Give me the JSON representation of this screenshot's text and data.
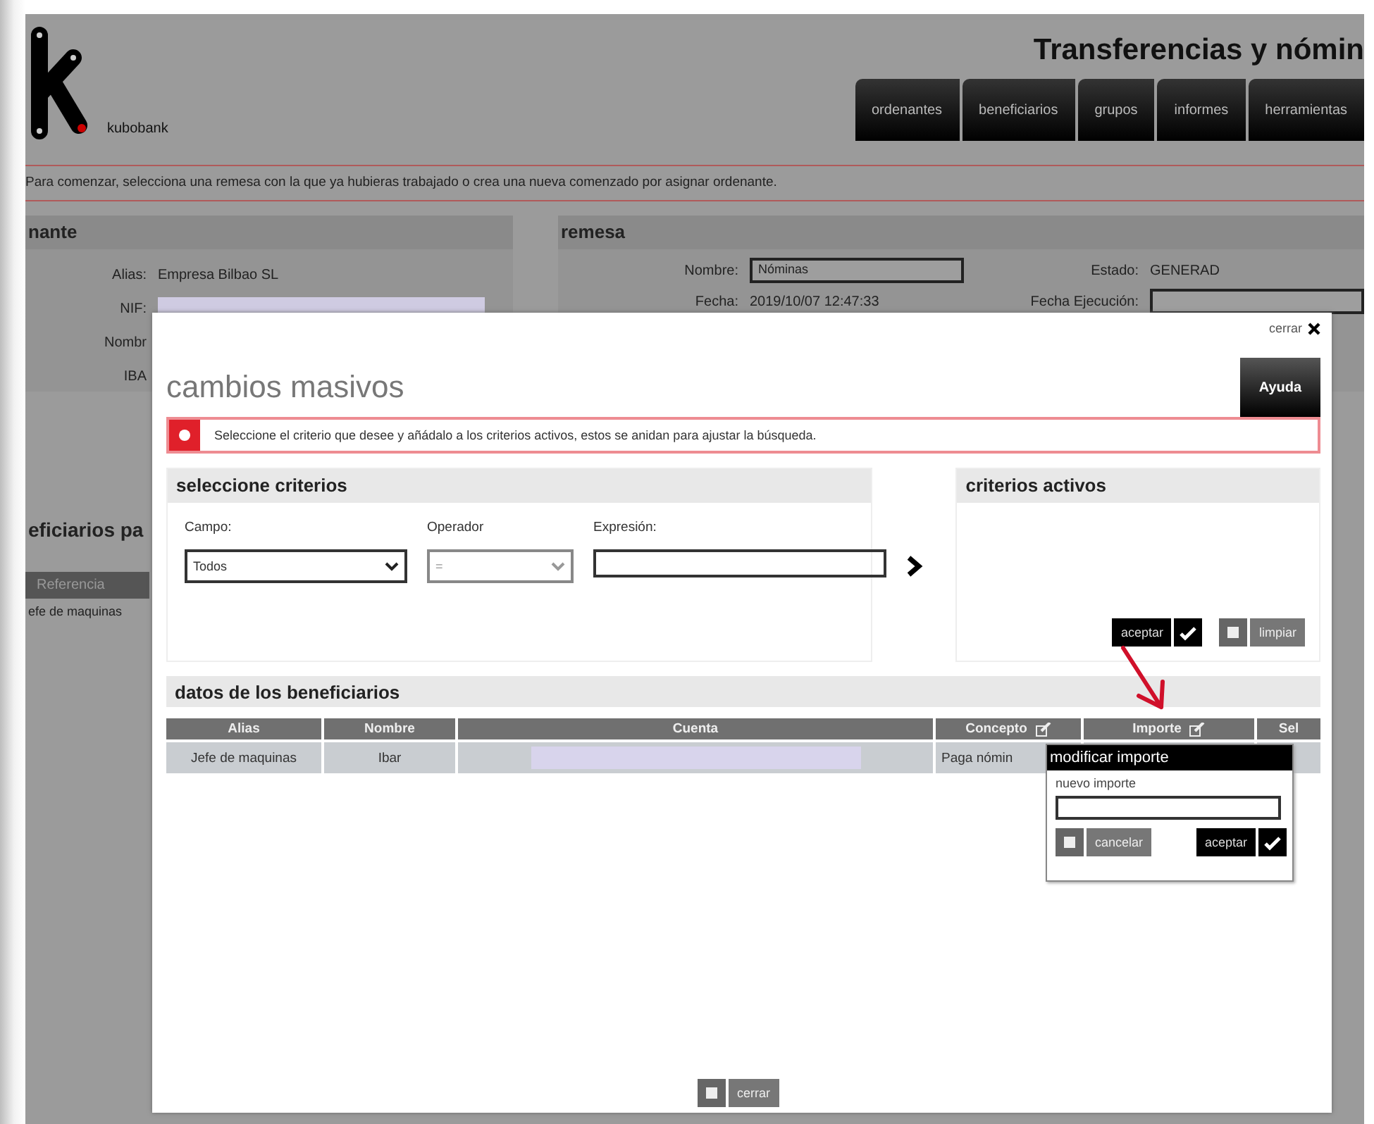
{
  "background_page": {
    "logo": {
      "name": "kubobank"
    },
    "title": "Transferencias y nómin",
    "nav_tabs": [
      {
        "label": "ordenantes"
      },
      {
        "label": "beneficiarios"
      },
      {
        "label": "grupos"
      },
      {
        "label": "informes"
      },
      {
        "label": "herramientas"
      }
    ],
    "message": "Para comenzar, selecciona una remesa con la que ya hubieras trabajado o crea una nueva comenzado por asignar ordenante.",
    "ordenante": {
      "title": "nante",
      "fields": [
        {
          "label": "Alias:",
          "kind": "text",
          "value": "Empresa Bilbao SL"
        },
        {
          "label": "NIF:",
          "kind": "redacted"
        },
        {
          "label": "Nombr",
          "kind": "label"
        },
        {
          "label": "IBA",
          "kind": "label"
        }
      ]
    },
    "remesa": {
      "title": "remesa",
      "fields": [
        {
          "label": "Nombre:",
          "kind": "input",
          "value": "Nóminas"
        },
        {
          "label": "Fecha:",
          "kind": "text",
          "value": "2019/10/07 12:47:33"
        }
      ],
      "fields_right": [
        {
          "label": "Estado:",
          "kind": "text",
          "value": "GENERAD"
        },
        {
          "label": "Fecha Ejecución:",
          "kind": "input"
        }
      ]
    },
    "beneficiarios": {
      "title": "eficiarios pa",
      "columns": [
        "Referencia"
      ],
      "rows": [
        [
          "efe de maquinas"
        ]
      ]
    }
  },
  "modal": {
    "title": "cambios masivos",
    "close_label": "cerrar",
    "help_button": "Ayuda",
    "alert": "Seleccione el criterio que desee y añádalo a los criterios activos, estos se anidan para ajustar la búsqueda.",
    "criteria": {
      "title": "seleccione criterios",
      "fields": [
        {
          "label": "Campo:",
          "kind": "select",
          "value": "Todos",
          "disabled": false
        },
        {
          "label": "Operador",
          "kind": "select",
          "value": "=",
          "disabled": true
        },
        {
          "label": "Expresión:",
          "kind": "input"
        }
      ]
    },
    "active_criteria": {
      "title": "criterios activos",
      "buttons": [
        {
          "label": "aceptar",
          "kind": "accept"
        },
        {
          "label": "limpiar",
          "kind": "clear"
        }
      ]
    },
    "beneficiaries": {
      "title": "datos de los beneficiarios",
      "columns": [
        {
          "label": "Alias",
          "editable": false
        },
        {
          "label": "Nombre",
          "editable": false
        },
        {
          "label": "Cuenta",
          "editable": false
        },
        {
          "label": "Concepto",
          "editable": true
        },
        {
          "label": "Importe",
          "editable": true
        },
        {
          "label": "Sel",
          "editable": false
        }
      ],
      "rows": [
        {
          "cells": [
            {
              "kind": "text",
              "text": "Jefe de maquinas"
            },
            {
              "kind": "text",
              "text": "Ibar"
            },
            {
              "kind": "redacted"
            },
            {
              "kind": "text",
              "text": "Paga nómin"
            }
          ]
        }
      ]
    },
    "popup": {
      "title": "modificar importe",
      "field_label": "nuevo importe",
      "buttons": [
        {
          "label": "cancelar",
          "kind": "clear"
        },
        {
          "label": "aceptar",
          "kind": "accept"
        }
      ]
    },
    "footer_button": "cerrar"
  }
}
